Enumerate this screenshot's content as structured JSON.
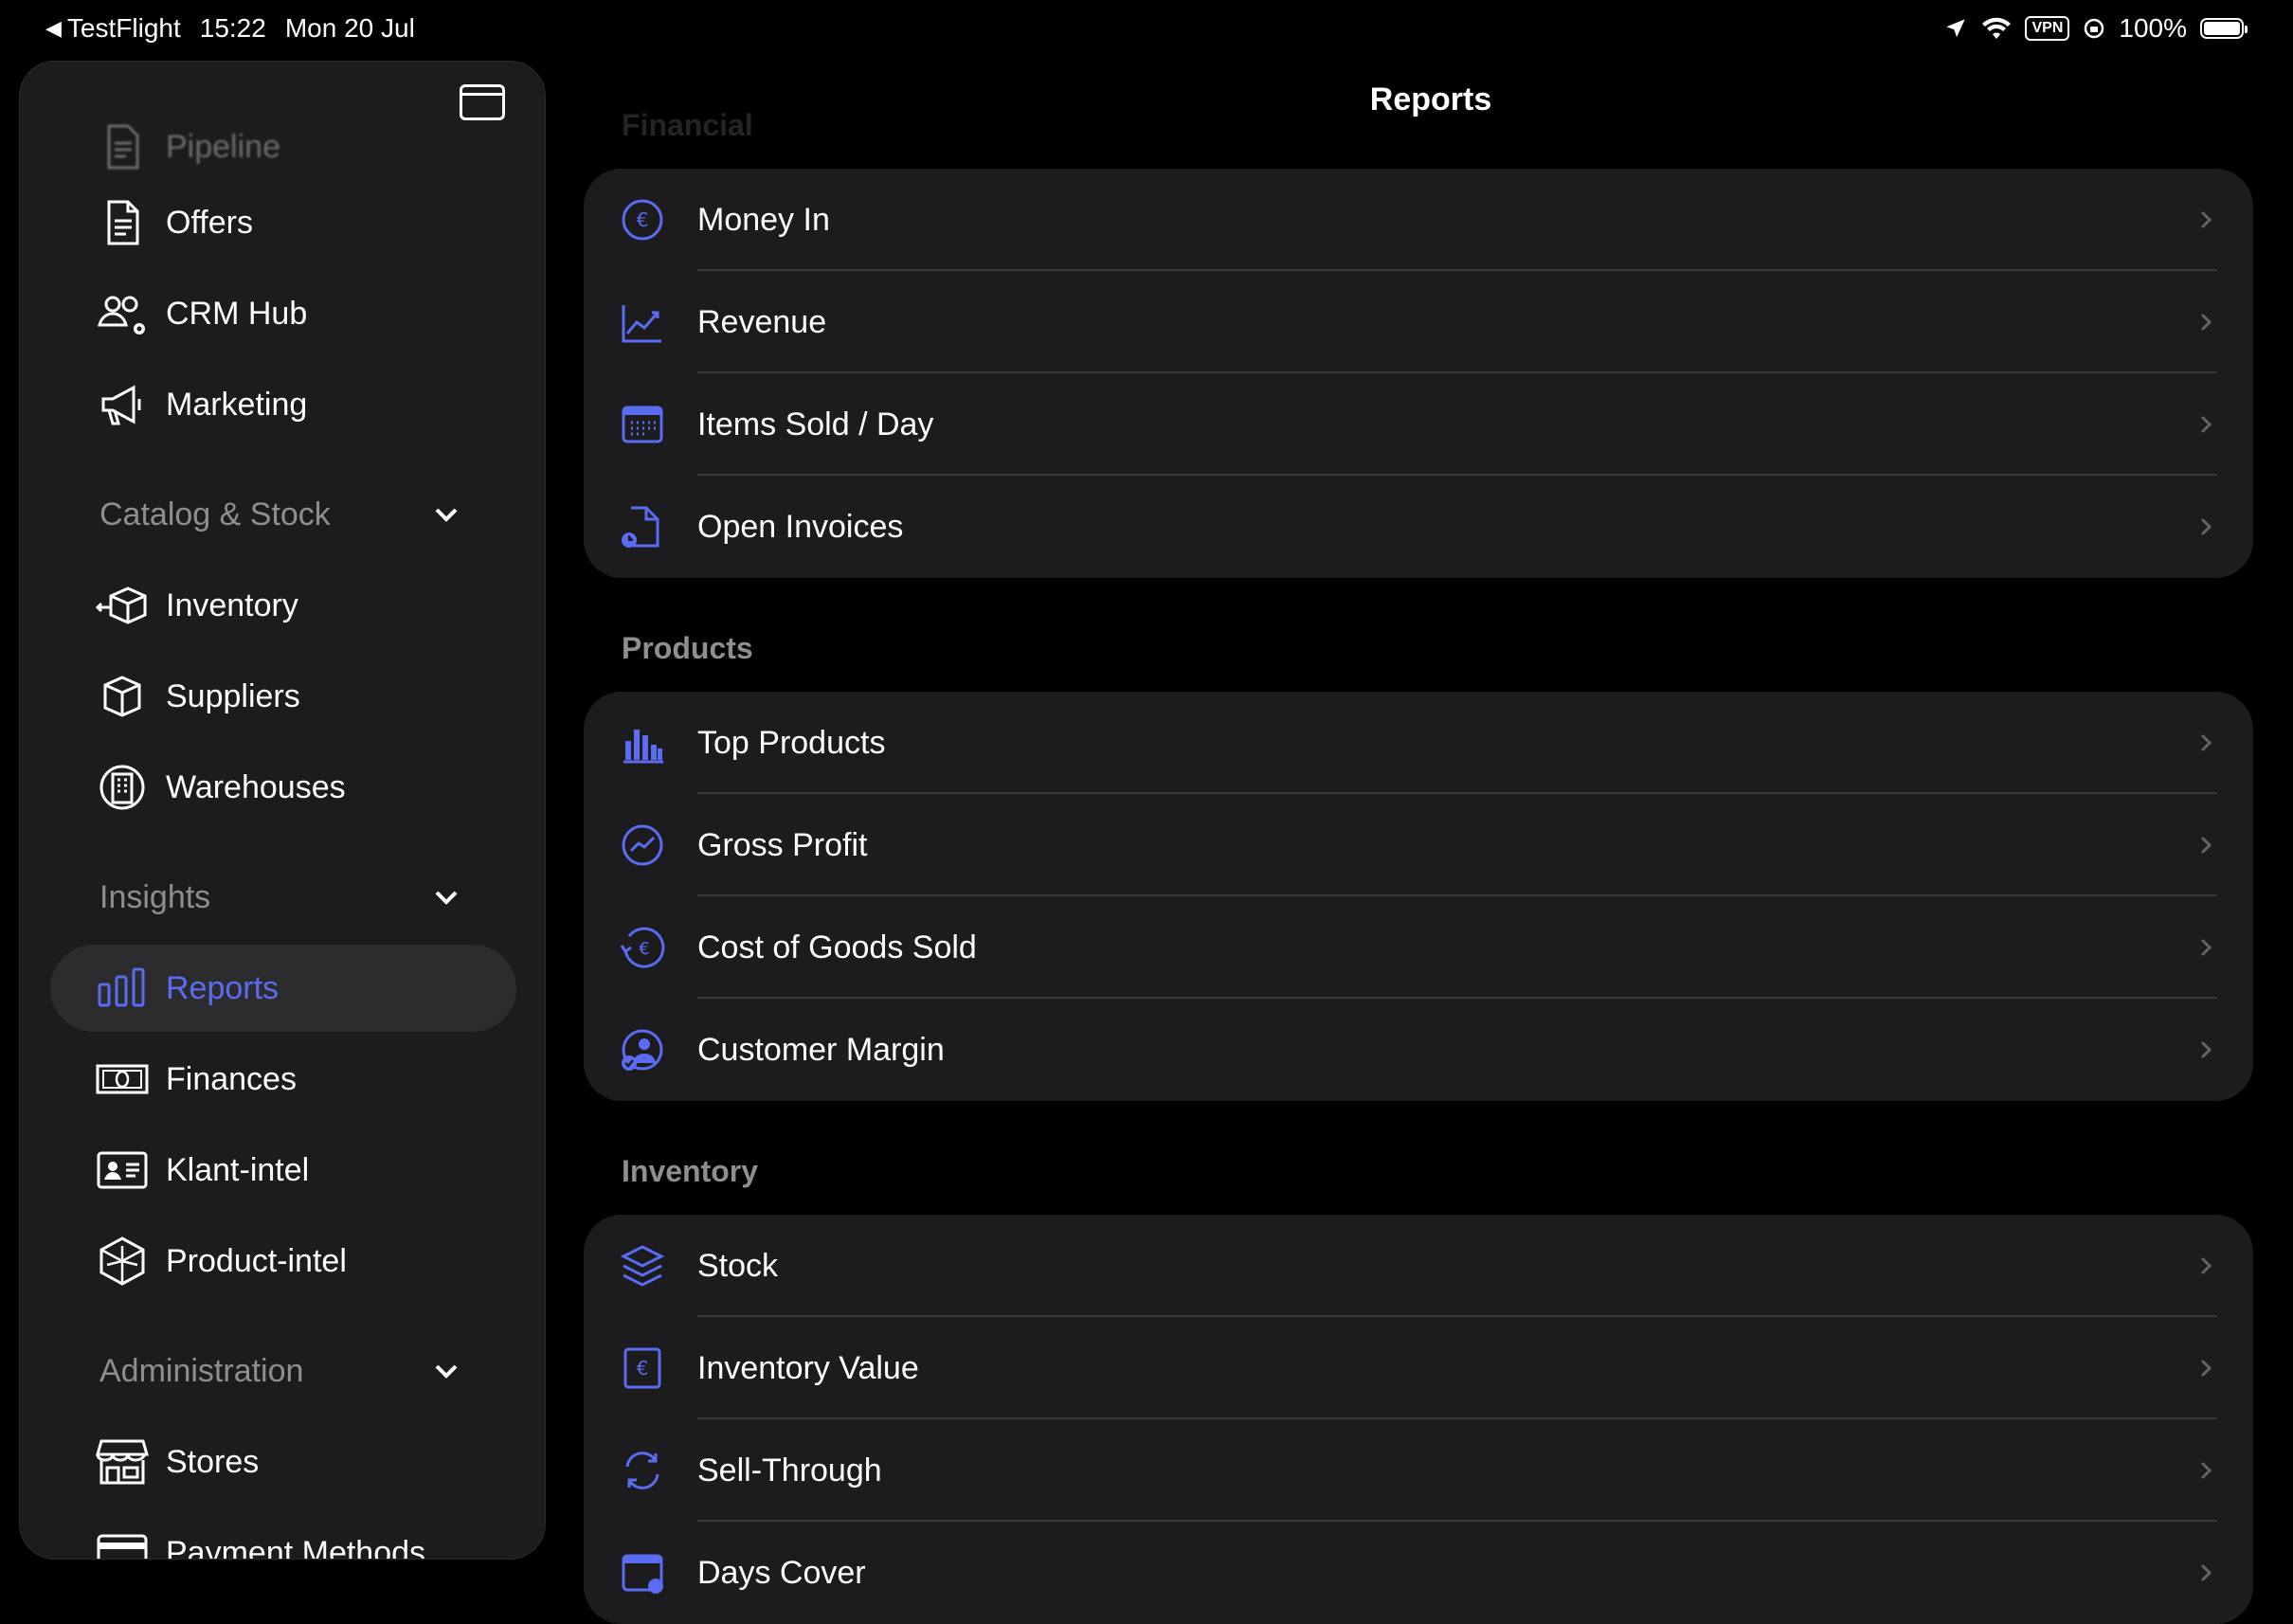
{
  "status_bar": {
    "back_app": "TestFlight",
    "time": "15:22",
    "date": "Mon 20 Jul",
    "vpn": "VPN",
    "battery": "100%"
  },
  "sidebar": {
    "items_top": [
      {
        "label": "Pipeline",
        "icon": "document-icon"
      },
      {
        "label": "Offers",
        "icon": "document-icon"
      },
      {
        "label": "CRM Hub",
        "icon": "people-gear-icon"
      },
      {
        "label": "Marketing",
        "icon": "megaphone-icon"
      }
    ],
    "sections": [
      {
        "title": "Catalog & Stock",
        "items": [
          {
            "label": "Inventory",
            "icon": "box-arrow-icon"
          },
          {
            "label": "Suppliers",
            "icon": "box-icon"
          },
          {
            "label": "Warehouses",
            "icon": "building-icon"
          }
        ]
      },
      {
        "title": "Insights",
        "items": [
          {
            "label": "Reports",
            "icon": "bar-chart-icon",
            "selected": true
          },
          {
            "label": "Finances",
            "icon": "banknote-icon"
          },
          {
            "label": "Klant-intel",
            "icon": "id-card-icon"
          },
          {
            "label": "Product-intel",
            "icon": "cube-icon"
          }
        ]
      },
      {
        "title": "Administration",
        "items": [
          {
            "label": "Stores",
            "icon": "storefront-icon"
          },
          {
            "label": "Payment Methods",
            "icon": "credit-card-icon"
          }
        ]
      }
    ]
  },
  "main": {
    "title": "Reports",
    "accent_color": "#5b6cf2",
    "sections": [
      {
        "title": "Financial",
        "rows": [
          {
            "label": "Money In",
            "icon": "euro-circle-icon"
          },
          {
            "label": "Revenue",
            "icon": "line-chart-icon"
          },
          {
            "label": "Items Sold / Day",
            "icon": "calendar-icon"
          },
          {
            "label": "Open Invoices",
            "icon": "doc-clock-icon"
          }
        ]
      },
      {
        "title": "Products",
        "rows": [
          {
            "label": "Top Products",
            "icon": "bar-chart-icon"
          },
          {
            "label": "Gross Profit",
            "icon": "chart-circle-icon"
          },
          {
            "label": "Cost of Goods Sold",
            "icon": "euro-arrow-icon"
          },
          {
            "label": "Customer Margin",
            "icon": "person-check-icon"
          }
        ]
      },
      {
        "title": "Inventory",
        "rows": [
          {
            "label": "Stock",
            "icon": "layers-icon"
          },
          {
            "label": "Inventory Value",
            "icon": "euro-square-icon"
          },
          {
            "label": "Sell-Through",
            "icon": "refresh-icon"
          },
          {
            "label": "Days Cover",
            "icon": "calendar-clock-icon"
          }
        ]
      }
    ]
  }
}
